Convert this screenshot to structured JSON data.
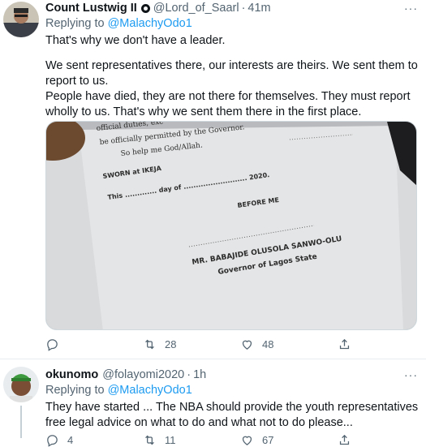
{
  "tweets": [
    {
      "display_name": "Count Lustwig II",
      "handle": "@Lord_of_Saarl",
      "separator": "·",
      "time": "41m",
      "more": "···",
      "replying_prefix": "Replying to ",
      "replying_to": "@MalachyOdo1",
      "paragraphs": [
        "That's why we don't have a leader.",
        "We sent representatives there, our interests are theirs. We sent them to report to us.\nPeople have died, they are not there for themselves. They must report wholly to us. That's why we sent them there in the first place."
      ],
      "media": {
        "line1": "official duties, exc",
        "line2": "be officially permitted by the Governor.",
        "line3": "So help me God/Allah.",
        "sworn": "SWORN at IKEJA",
        "date_line": "This ............. day of .......................... 2020.",
        "before_me": "BEFORE ME",
        "signatory": "MR. BABAJIDE OLUSOLA SANWO-OLU",
        "title": "Governor of Lagos State"
      },
      "reply_count": "",
      "retweet_count": "28",
      "like_count": "48"
    },
    {
      "display_name": "okunomo",
      "handle": "@folayomi2020",
      "separator": "·",
      "time": "1h",
      "more": "···",
      "replying_prefix": "Replying to ",
      "replying_to": "@MalachyOdo1",
      "paragraphs": [
        "They have started ... The NBA should provide the youth representatives free legal advice on what to do and what not to do please..."
      ],
      "reply_count": "4",
      "retweet_count": "11",
      "like_count": "67"
    }
  ],
  "icons": {
    "reply": "reply-icon",
    "retweet": "retweet-icon",
    "like": "heart-icon",
    "share": "share-icon",
    "more": "more-icon"
  },
  "colors": {
    "link": "#1d9bf0",
    "muted": "#536471",
    "text": "#0f1419",
    "divider": "#e6ecf0"
  }
}
